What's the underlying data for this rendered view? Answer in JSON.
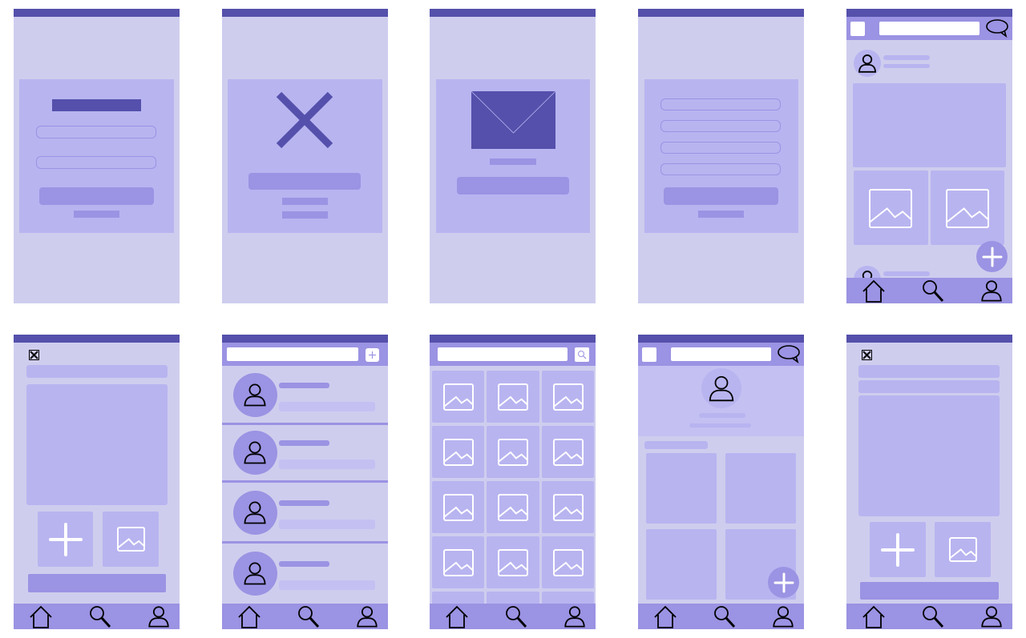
{
  "colors": {
    "status_bar": "#5550AB",
    "screen_bg": "#CFCDEE",
    "card": "#B8B4F0",
    "accent": "#9B93E3",
    "profile_header": "#C4C0F2",
    "white": "#FFFFFF",
    "icon_stroke": "#000000"
  },
  "screens": [
    {
      "name": "login-screen"
    },
    {
      "name": "error-screen",
      "icon": "x-icon"
    },
    {
      "name": "email-confirmation-screen",
      "icon": "envelope-icon"
    },
    {
      "name": "registration-screen"
    },
    {
      "name": "feed-screen",
      "icons": [
        "menu-icon",
        "chat-icon",
        "avatar-icon",
        "image-icon",
        "plus-icon"
      ]
    },
    {
      "name": "new-post-screen",
      "icons": [
        "close-icon",
        "plus-icon",
        "image-icon"
      ]
    },
    {
      "name": "contacts-list-screen",
      "icons": [
        "add-icon",
        "avatar-icon"
      ]
    },
    {
      "name": "gallery-search-screen",
      "icons": [
        "search-icon",
        "image-icon"
      ]
    },
    {
      "name": "profile-screen",
      "icons": [
        "chat-icon",
        "avatar-icon",
        "plus-icon"
      ]
    },
    {
      "name": "edit-post-screen",
      "icons": [
        "close-icon",
        "plus-icon",
        "image-icon"
      ]
    }
  ],
  "bottom_nav": [
    "home-icon",
    "search-icon",
    "user-icon"
  ]
}
